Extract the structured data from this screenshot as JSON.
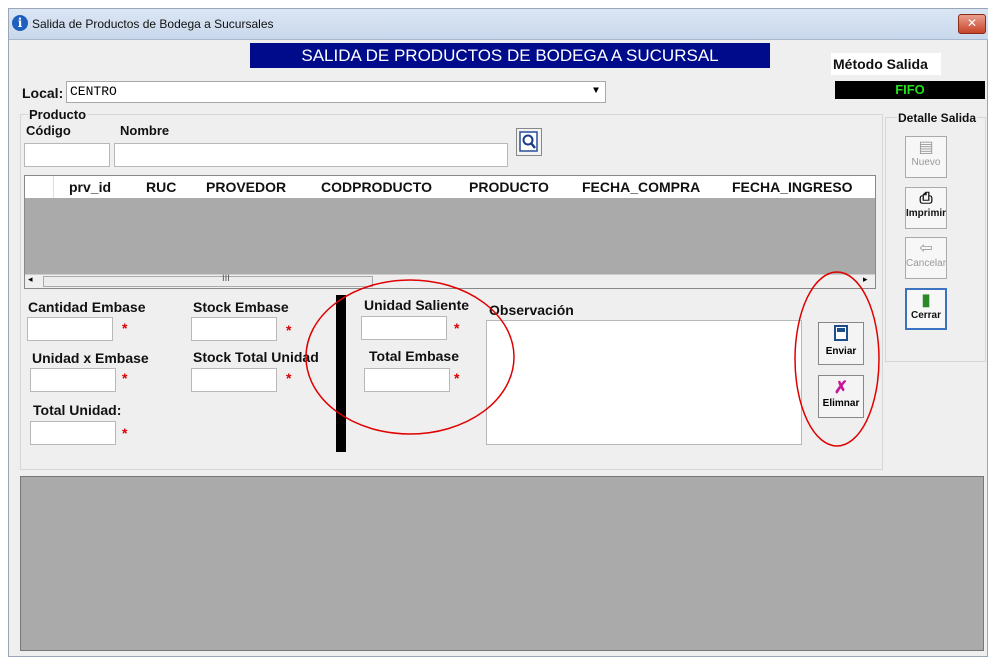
{
  "window": {
    "title": "Salida de Productos de Bodega a Sucursales",
    "close": "✕"
  },
  "banner": "SALIDA DE PRODUCTOS DE BODEGA A SUCURSAL",
  "metodo": {
    "label": "Método Salida",
    "value": "FIFO"
  },
  "local": {
    "label": "Local:",
    "value": "CENTRO"
  },
  "producto": {
    "group_label": "Producto",
    "codigo_label": "Código",
    "nombre_label": "Nombre",
    "codigo_value": "",
    "nombre_value": "",
    "search_icon": "search-icon"
  },
  "grid": {
    "columns": [
      "prv_id",
      "RUC",
      "PROVEDOR",
      "CODPRODUCTO",
      "PRODUCTO",
      "FECHA_COMPRA",
      "FECHA_INGRESO"
    ],
    "rows": [],
    "scroll_marker": "III"
  },
  "detalle": {
    "label": "Detalle Salida",
    "buttons": [
      {
        "label": "Nuevo",
        "icon": "document-icon"
      },
      {
        "label": "Imprimir",
        "icon": "printer-icon"
      },
      {
        "label": "Cancelar",
        "icon": "undo-icon"
      },
      {
        "label": "Cerrar",
        "icon": "exit-door-icon"
      }
    ]
  },
  "fields": {
    "cantidad_embase": "Cantidad Embase",
    "stock_embase": "Stock Embase",
    "unidad_x_embase": "Unidad x Embase",
    "stock_total_unidad": "Stock Total Unidad",
    "total_unidad": "Total Unidad:",
    "unidad_saliente": "Unidad Saliente",
    "total_embase": "Total Embase",
    "observacion": "Observación",
    "required_mark": "*"
  },
  "actions": {
    "enviar": {
      "label": "Enviar",
      "icon": "save-icon"
    },
    "eliminar": {
      "label": "Elimnar",
      "icon": "delete-x-icon"
    }
  },
  "colors": {
    "banner": "#000b8c",
    "fifo_text": "#23e11d",
    "required": "#d00000",
    "annotation": "#e00000"
  }
}
